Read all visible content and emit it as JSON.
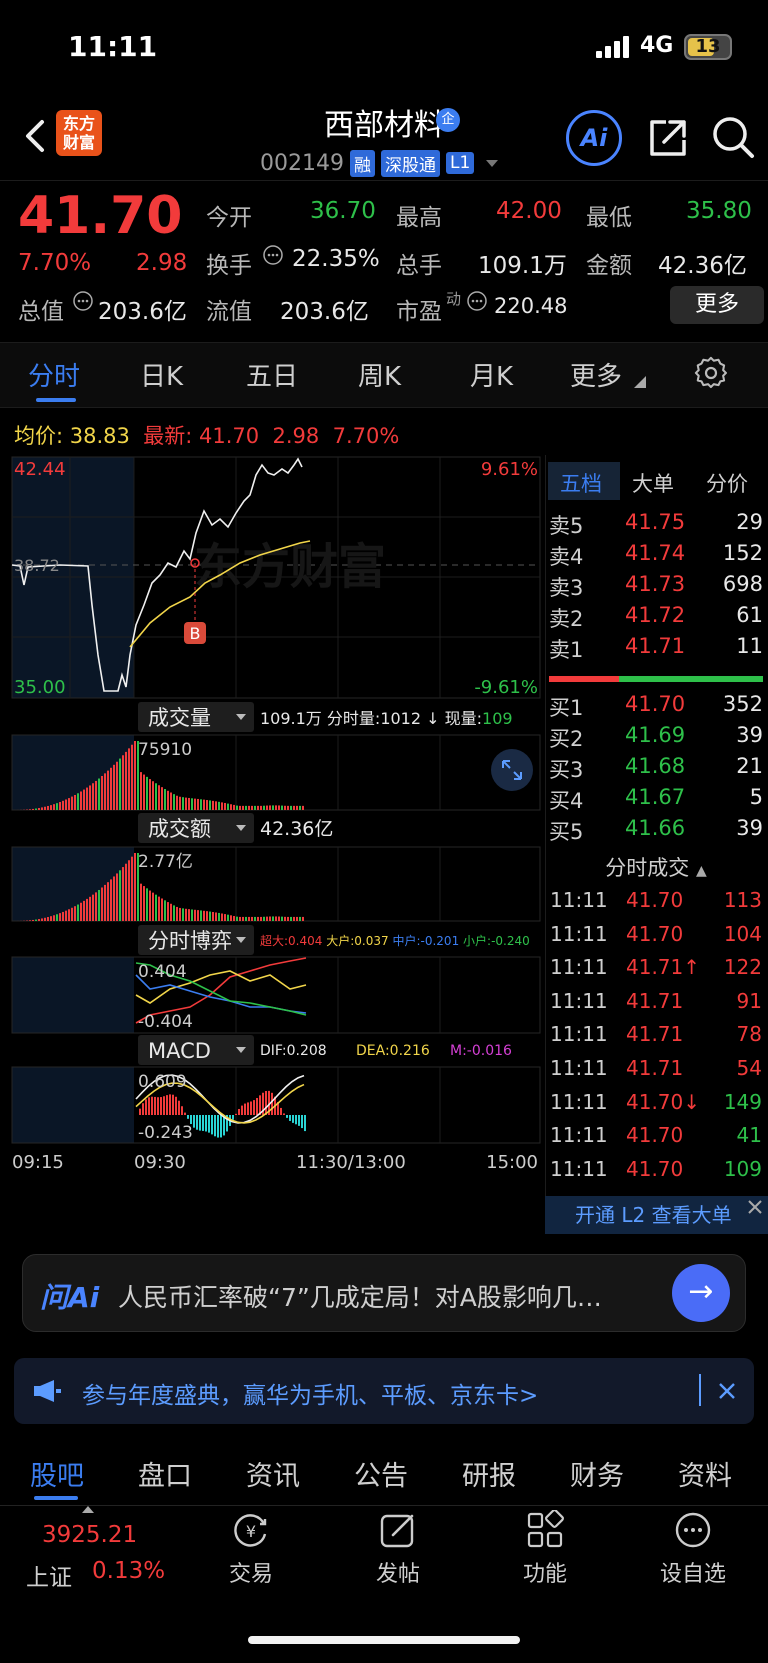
{
  "status_bar": {
    "time": "11:11",
    "network": "4G",
    "battery": "13"
  },
  "header": {
    "logo_line1": "东方",
    "logo_line2": "财富",
    "stock_name": "西部材料",
    "name_badge": "企",
    "stock_code": "002149",
    "tags": [
      "融",
      "深股通",
      "L1"
    ],
    "ai_label": "Ai"
  },
  "quote": {
    "price": "41.70",
    "change_pct": "7.70%",
    "change": "2.98",
    "open_label": "今开",
    "open": "36.70",
    "high_label": "最高",
    "high": "42.00",
    "low_label": "最低",
    "low": "35.80",
    "turnover_label": "换手",
    "turnover": "22.35%",
    "volume_label": "总手",
    "volume": "109.1万",
    "amount_label": "金额",
    "amount": "42.36亿",
    "mktcap_label": "总值",
    "mktcap": "203.6亿",
    "float_label": "流值",
    "float": "203.6亿",
    "pe_label": "市盈",
    "pe_sup": "动",
    "pe": "220.48",
    "more_label": "更多"
  },
  "chart_tabs": [
    "分时",
    "日K",
    "五日",
    "周K",
    "月K",
    "更多"
  ],
  "avg_row": {
    "avg_label": "均价:",
    "avg": "38.83",
    "latest_label": "最新:",
    "latest": "41.70",
    "chg": "2.98",
    "pct": "7.70%"
  },
  "chart_data": {
    "type": "line",
    "price_axis": {
      "top": "42.44",
      "mid": "38.72",
      "bottom": "35.00",
      "top_pct": "9.61%",
      "bottom_pct": "-9.61%"
    },
    "watermark": "东方财富",
    "marker": "B",
    "volume_panel": {
      "label": "成交量",
      "total": "109.1万",
      "minute_label": "分时量:",
      "minute": "1012",
      "current_label": "现量:",
      "current": "109",
      "max": "75910"
    },
    "amount_panel": {
      "label": "成交额",
      "total": "42.36亿",
      "max": "2.77亿"
    },
    "game_panel": {
      "label": "分时博弈",
      "items": [
        {
          "name": "超大:",
          "value": "0.404",
          "color": "#f23b3b"
        },
        {
          "name": "大户:",
          "value": "0.037",
          "color": "#f1d54a"
        },
        {
          "name": "中户:",
          "value": "-0.201",
          "color": "#3b7df0"
        },
        {
          "name": "小户:",
          "value": "-0.240",
          "color": "#2ec04a"
        }
      ],
      "max": "0.404",
      "min": "-0.404"
    },
    "macd_panel": {
      "label": "MACD",
      "dif": "DIF:0.208",
      "dea": "DEA:0.216",
      "m": "M:-0.016",
      "max": "0.609",
      "min": "-0.243"
    },
    "time_axis": [
      "09:15",
      "09:30",
      "11:30/13:00",
      "15:00"
    ]
  },
  "order_book": {
    "tabs": [
      "五档",
      "大单",
      "分价"
    ],
    "asks": [
      {
        "label": "卖5",
        "price": "41.75",
        "vol": "29"
      },
      {
        "label": "卖4",
        "price": "41.74",
        "vol": "152"
      },
      {
        "label": "卖3",
        "price": "41.73",
        "vol": "698"
      },
      {
        "label": "卖2",
        "price": "41.72",
        "vol": "61"
      },
      {
        "label": "卖1",
        "price": "41.71",
        "vol": "11"
      }
    ],
    "bids": [
      {
        "label": "买1",
        "price": "41.70",
        "vol": "352"
      },
      {
        "label": "买2",
        "price": "41.69",
        "vol": "39"
      },
      {
        "label": "买3",
        "price": "41.68",
        "vol": "21"
      },
      {
        "label": "买4",
        "price": "41.67",
        "vol": "5"
      },
      {
        "label": "买5",
        "price": "41.66",
        "vol": "39"
      }
    ],
    "trades_title": "分时成交",
    "trades": [
      {
        "time": "11:11",
        "price": "41.70",
        "vol": "113",
        "dir": "buy"
      },
      {
        "time": "11:11",
        "price": "41.70",
        "vol": "104",
        "dir": "buy"
      },
      {
        "time": "11:11",
        "price": "41.71↑",
        "vol": "122",
        "dir": "buy"
      },
      {
        "time": "11:11",
        "price": "41.71",
        "vol": "91",
        "dir": "buy"
      },
      {
        "time": "11:11",
        "price": "41.71",
        "vol": "78",
        "dir": "buy"
      },
      {
        "time": "11:11",
        "price": "41.71",
        "vol": "54",
        "dir": "buy"
      },
      {
        "time": "11:11",
        "price": "41.70↓",
        "vol": "149",
        "dir": "sell"
      },
      {
        "time": "11:11",
        "price": "41.70",
        "vol": "41",
        "dir": "sell"
      },
      {
        "time": "11:11",
        "price": "41.70",
        "vol": "109",
        "dir": "sell"
      }
    ],
    "l2_banner": "开通 L2 查看大单"
  },
  "ai_question": {
    "logo": "问Ai",
    "text": "人民币汇率破“7”几成定局！对A股影响几…"
  },
  "promo": {
    "text": "参与年度盛典，赢华为手机、平板、京东卡>"
  },
  "bottom_tabs": [
    "股吧",
    "盘口",
    "资讯",
    "公告",
    "研报",
    "财务",
    "资料"
  ],
  "bottom_nav": {
    "index_value": "3925.21",
    "index_name": "上证",
    "index_pct": "0.13%",
    "items": [
      "交易",
      "发帖",
      "功能",
      "设自选"
    ]
  }
}
